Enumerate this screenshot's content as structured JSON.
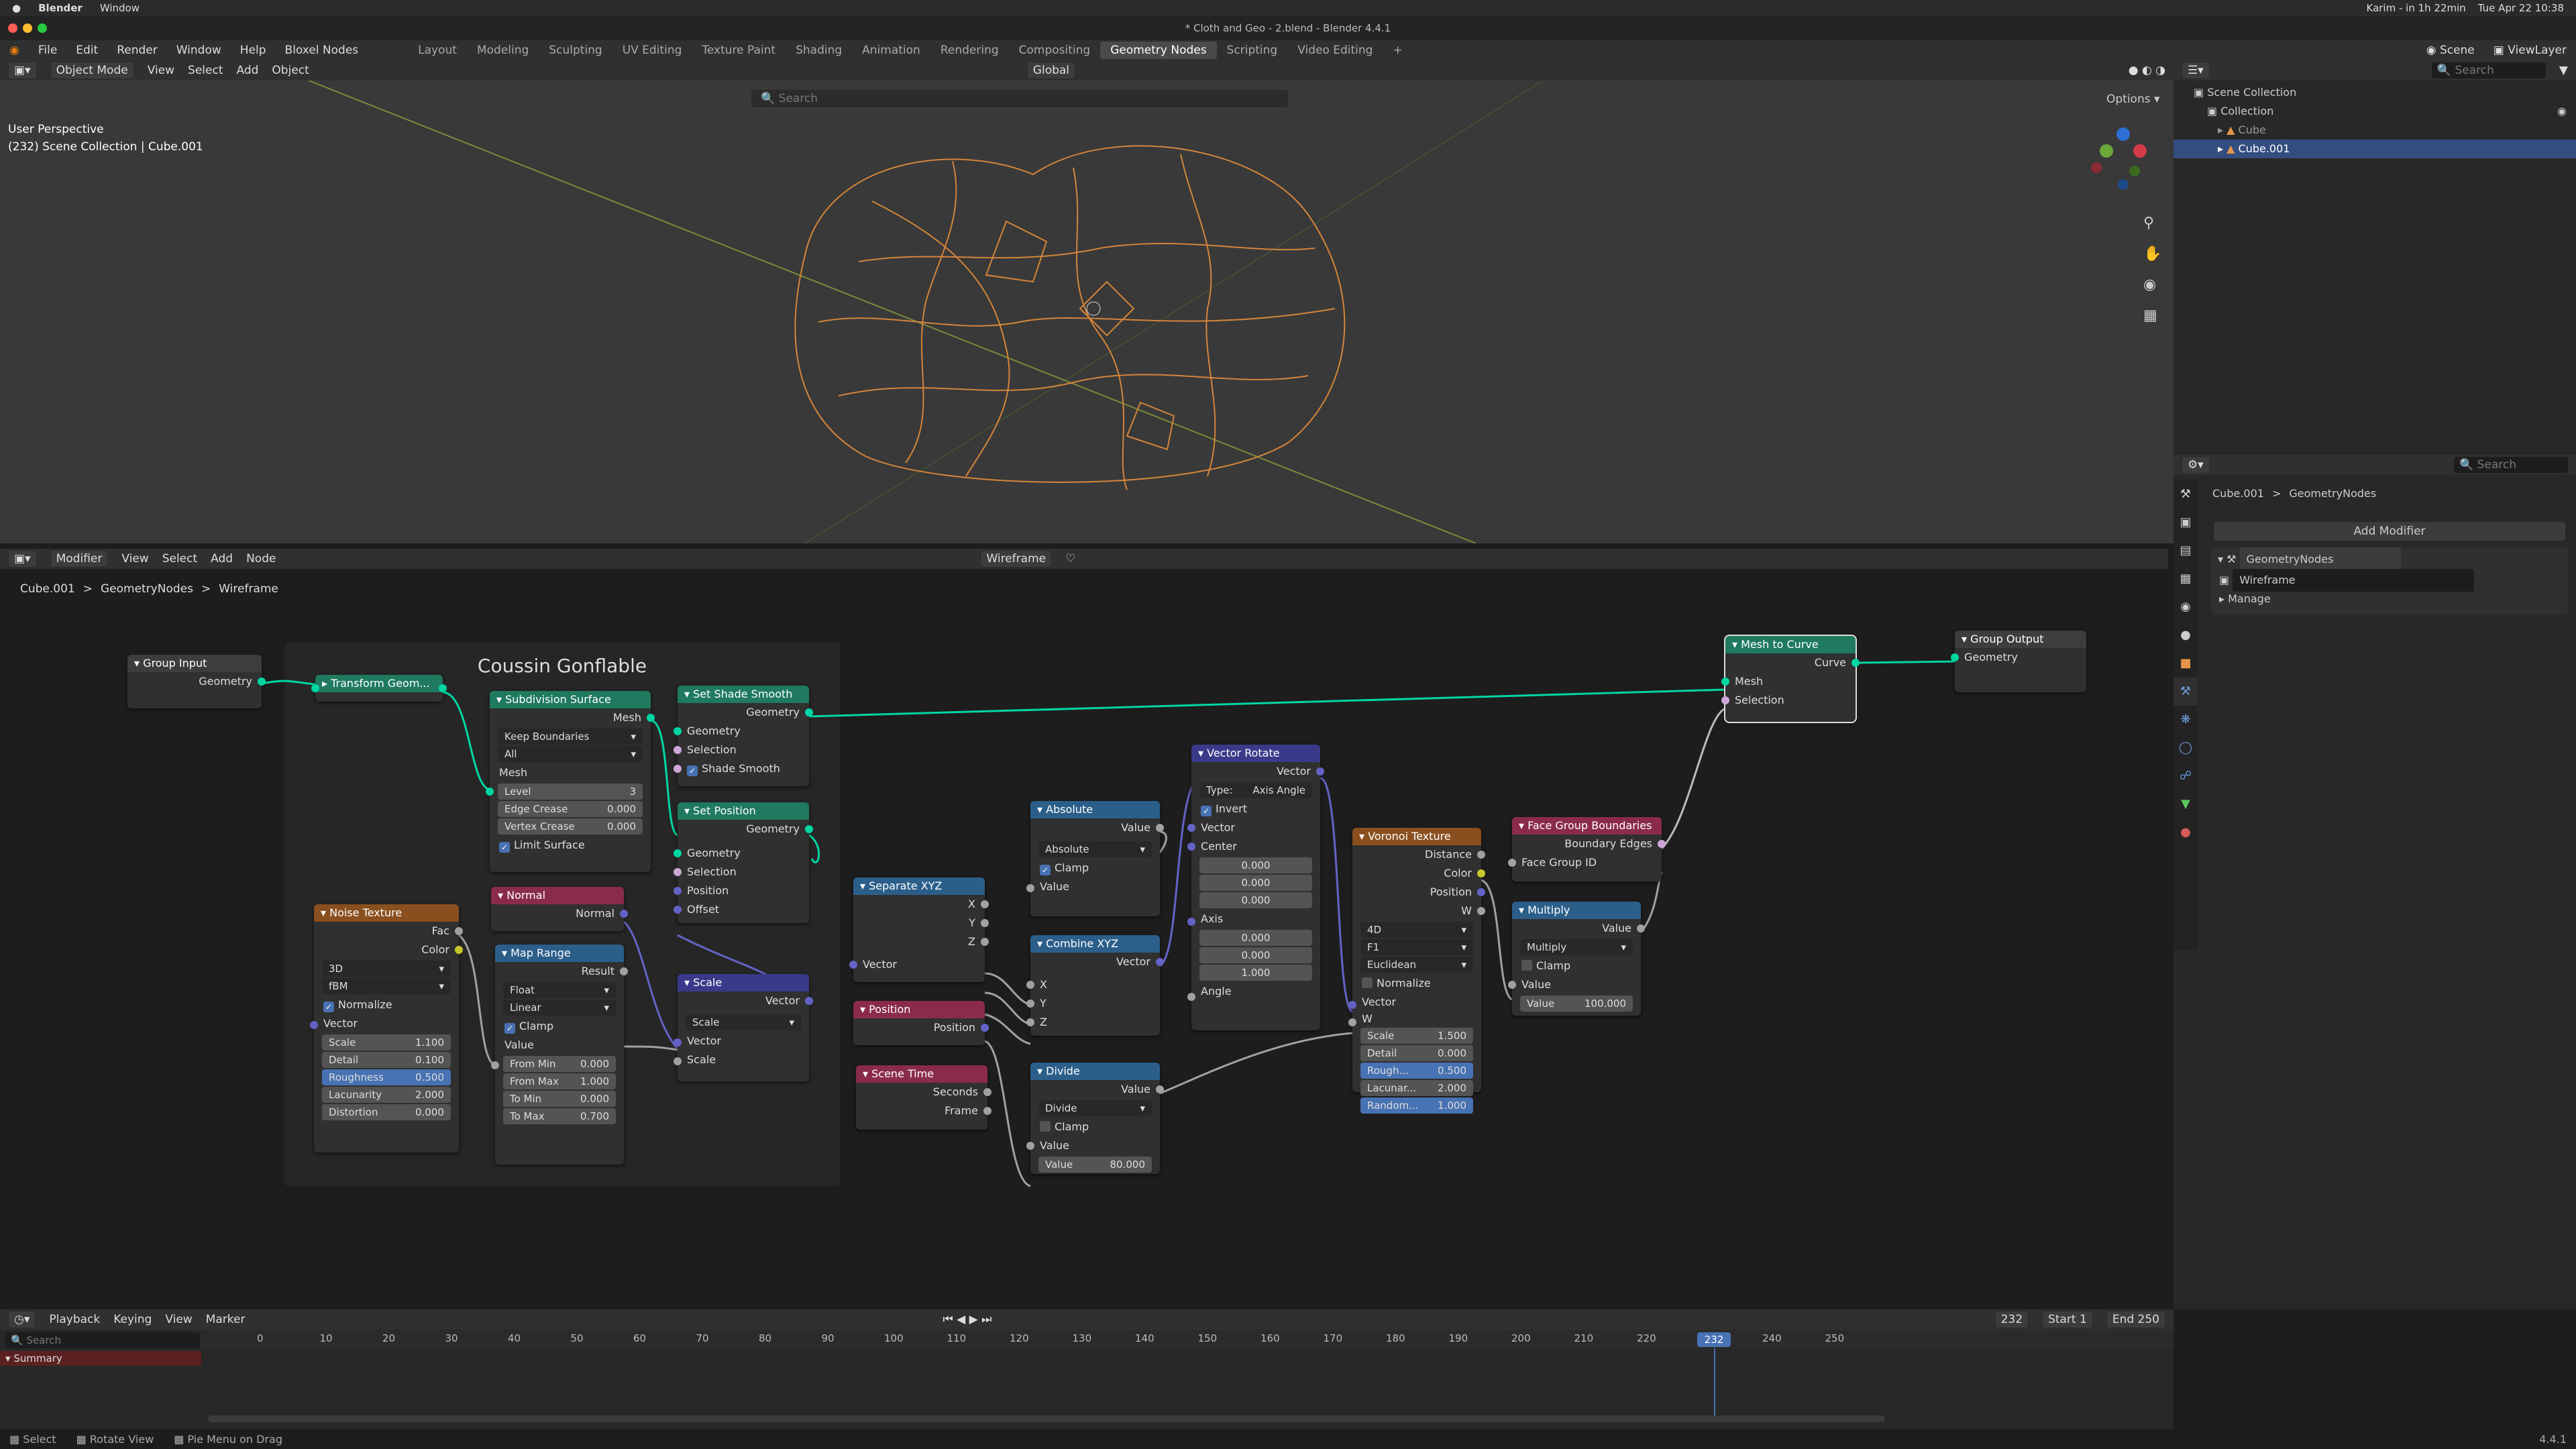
{
  "mac_menu": {
    "apple": "",
    "app": "Blender",
    "window": "Window",
    "right_user": "Karim - in 1h 22min",
    "right_date": "Tue Apr 22 10:38"
  },
  "window_title": "* Cloth and Geo - 2.blend - Blender 4.4.1",
  "menus": [
    "File",
    "Edit",
    "Render",
    "Window",
    "Help",
    "Bloxel Nodes"
  ],
  "workspaces": [
    "Layout",
    "Modeling",
    "Sculpting",
    "UV Editing",
    "Texture Paint",
    "Shading",
    "Animation",
    "Rendering",
    "Compositing",
    "Geometry Nodes",
    "Scripting",
    "Video Editing",
    "+"
  ],
  "active_workspace": "Geometry Nodes",
  "scene": {
    "scene_label": "Scene",
    "viewlayer_label": "ViewLayer"
  },
  "viewport": {
    "mode": "Object Mode",
    "menus": [
      "View",
      "Select",
      "Add",
      "Object"
    ],
    "transform": "Global",
    "search_placeholder": "Search",
    "options": "Options",
    "overlay_line1": "User Perspective",
    "overlay_line2": "(232) Scene Collection | Cube.001",
    "wire_color": "#d4853a"
  },
  "node_editor": {
    "type_menu": "Modifier",
    "menus": [
      "View",
      "Select",
      "Add",
      "Node"
    ],
    "tree_name": "Wireframe",
    "breadcrumb": [
      "Cube.001",
      "GeometryNodes",
      "Wireframe"
    ],
    "frame_label": "Coussin Gonflable"
  },
  "nodes": {
    "group_input": {
      "title": "Group Input",
      "geometry": "Geometry"
    },
    "transform": {
      "title": "Transform Geom..."
    },
    "subdiv": {
      "title": "Subdivision Surface",
      "mesh_out": "Mesh",
      "uv": "Keep Boundaries",
      "boundary": "All",
      "mesh_in": "Mesh",
      "level_label": "Level",
      "level": "3",
      "edge_label": "Edge Crease",
      "edge": "0.000",
      "vertex_label": "Vertex Crease",
      "vertex": "0.000",
      "limit": "Limit Surface"
    },
    "shade_smooth": {
      "title": "Set Shade Smooth",
      "geometry_out": "Geometry",
      "geometry_in": "Geometry",
      "selection": "Selection",
      "shade": "Shade Smooth"
    },
    "set_position": {
      "title": "Set Position",
      "geometry_out": "Geometry",
      "geometry_in": "Geometry",
      "selection": "Selection",
      "position": "Position",
      "offset": "Offset"
    },
    "noise": {
      "title": "Noise Texture",
      "fac": "Fac",
      "color": "Color",
      "dim": "3D",
      "type": "fBM",
      "normalize": "Normalize",
      "vector": "Vector",
      "scale_l": "Scale",
      "scale": "1.100",
      "detail_l": "Detail",
      "detail": "0.100",
      "rough_l": "Roughness",
      "rough": "0.500",
      "lac_l": "Lacunarity",
      "lac": "2.000",
      "dist_l": "Distortion",
      "dist": "0.000"
    },
    "normal": {
      "title": "Normal",
      "normal": "Normal"
    },
    "map_range": {
      "title": "Map Range",
      "result": "Result",
      "dtype": "Float",
      "interp": "Linear",
      "clamp": "Clamp",
      "value": "Value",
      "fmin_l": "From Min",
      "fmin": "0.000",
      "fmax_l": "From Max",
      "fmax": "1.000",
      "tmin_l": "To Min",
      "tmin": "0.000",
      "tmax_l": "To Max",
      "tmax": "0.700"
    },
    "scale": {
      "title": "Scale",
      "vector_out": "Vector",
      "mode": "Scale",
      "vector_in": "Vector",
      "scale": "Scale"
    },
    "separate": {
      "title": "Separate XYZ",
      "x": "X",
      "y": "Y",
      "z": "Z",
      "vector": "Vector"
    },
    "position": {
      "title": "Position",
      "position": "Position"
    },
    "scene_time": {
      "title": "Scene Time",
      "seconds": "Seconds",
      "frame": "Frame"
    },
    "absolute": {
      "title": "Absolute",
      "value_out": "Value",
      "op": "Absolute",
      "clamp": "Clamp",
      "value_in": "Value"
    },
    "combine": {
      "title": "Combine XYZ",
      "vector": "Vector",
      "x": "X",
      "y": "Y",
      "z": "Z"
    },
    "divide": {
      "title": "Divide",
      "value_out": "Value",
      "op": "Divide",
      "clamp": "Clamp",
      "value_in": "Value",
      "value_l": "Value",
      "value": "80.000"
    },
    "vrot": {
      "title": "Vector Rotate",
      "vector_out": "Vector",
      "type_l": "Type:",
      "type": "Axis Angle",
      "invert": "Invert",
      "vector_in": "Vector",
      "center": "Center",
      "c1": "0.000",
      "c2": "0.000",
      "c3": "0.000",
      "axis": "Axis",
      "a1": "0.000",
      "a2": "0.000",
      "a3": "1.000",
      "angle": "Angle"
    },
    "voronoi": {
      "title": "Voronoi Texture",
      "distance": "Distance",
      "color": "Color",
      "position": "Position",
      "w_out": "W",
      "dim": "4D",
      "feature": "F1",
      "metric": "Euclidean",
      "normalize": "Normalize",
      "vector": "Vector",
      "w_in": "W",
      "scale_l": "Scale",
      "scale": "1.500",
      "detail_l": "Detail",
      "detail": "0.000",
      "rough_l": "Rough...",
      "rough": "0.500",
      "lac_l": "Lacunar...",
      "lac": "2.000",
      "rand_l": "Random...",
      "rand": "1.000"
    },
    "face_group": {
      "title": "Face Group Boundaries",
      "edges": "Boundary Edges",
      "face_id": "Face Group ID"
    },
    "multiply": {
      "title": "Multiply",
      "value_out": "Value",
      "op": "Multiply",
      "clamp": "Clamp",
      "value_in": "Value",
      "value_l": "Value",
      "value": "100.000"
    },
    "mesh_to_curve": {
      "title": "Mesh to Curve",
      "curve": "Curve",
      "mesh": "Mesh",
      "selection": "Selection"
    },
    "group_output": {
      "title": "Group Output",
      "geometry": "Geometry"
    }
  },
  "outliner": {
    "search": "Search",
    "items": [
      "Scene Collection",
      "Collection",
      "Cube",
      "Cube.001"
    ]
  },
  "properties": {
    "search": "Search",
    "breadcrumb": [
      "Cube.001",
      "GeometryNodes"
    ],
    "add_modifier": "Add Modifier",
    "modifier_name": "GeometryNodes",
    "tree": "Wireframe",
    "manage": "Manage"
  },
  "timeline": {
    "menus": [
      "Playback",
      "Keying",
      "View",
      "Marker"
    ],
    "current": "232",
    "start_l": "Start",
    "start": "1",
    "end_l": "End",
    "end": "250",
    "search": "Search",
    "summary": "Summary",
    "ticks": [
      "0",
      "10",
      "20",
      "30",
      "40",
      "50",
      "60",
      "70",
      "80",
      "90",
      "100",
      "110",
      "120",
      "130",
      "140",
      "150",
      "160",
      "170",
      "180",
      "190",
      "200",
      "210",
      "220",
      "230",
      "240",
      "250"
    ]
  },
  "status": {
    "select": "Select",
    "rotate": "Rotate View",
    "pie": "Pie Menu on Drag",
    "version": "4.4.1"
  }
}
